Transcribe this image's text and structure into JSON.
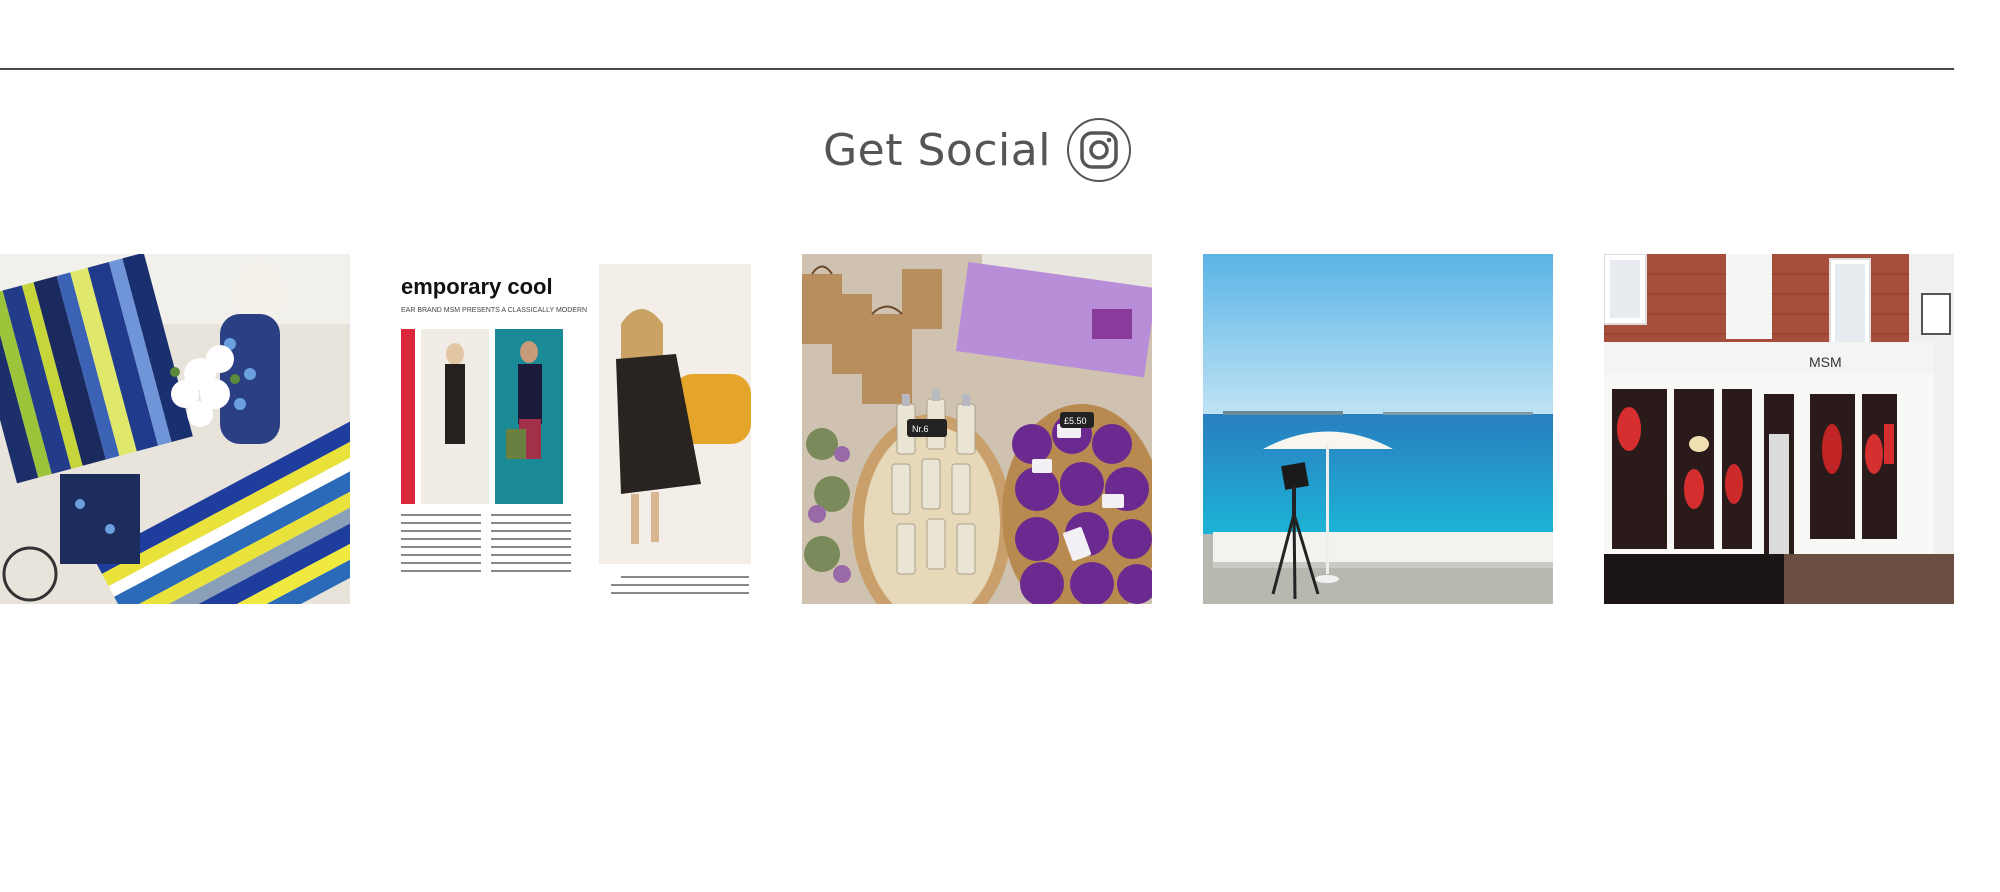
{
  "section": {
    "heading": "Get Social",
    "icon": "instagram-icon"
  },
  "gallery": {
    "items": [
      {
        "name": "clothing-rack-photo"
      },
      {
        "name": "magazine-feature-photo",
        "headline": "emporary cool",
        "subheadline": "EAR BRAND MSM PRESENTS A CLASSICALLY MODERN"
      },
      {
        "name": "bottles-and-lavender-photo",
        "tag1": "Nr.6",
        "tag2": "£5.50"
      },
      {
        "name": "seaside-umbrella-photo"
      },
      {
        "name": "shop-front-photo",
        "sign": "MSM"
      }
    ]
  },
  "colors": {
    "text": "#555555",
    "divider": "#4a4a4a",
    "sea": "#1a9fd0",
    "sky": "#7cc4ea",
    "brick": "#b0533d",
    "lavender": "#7a3fa8"
  }
}
